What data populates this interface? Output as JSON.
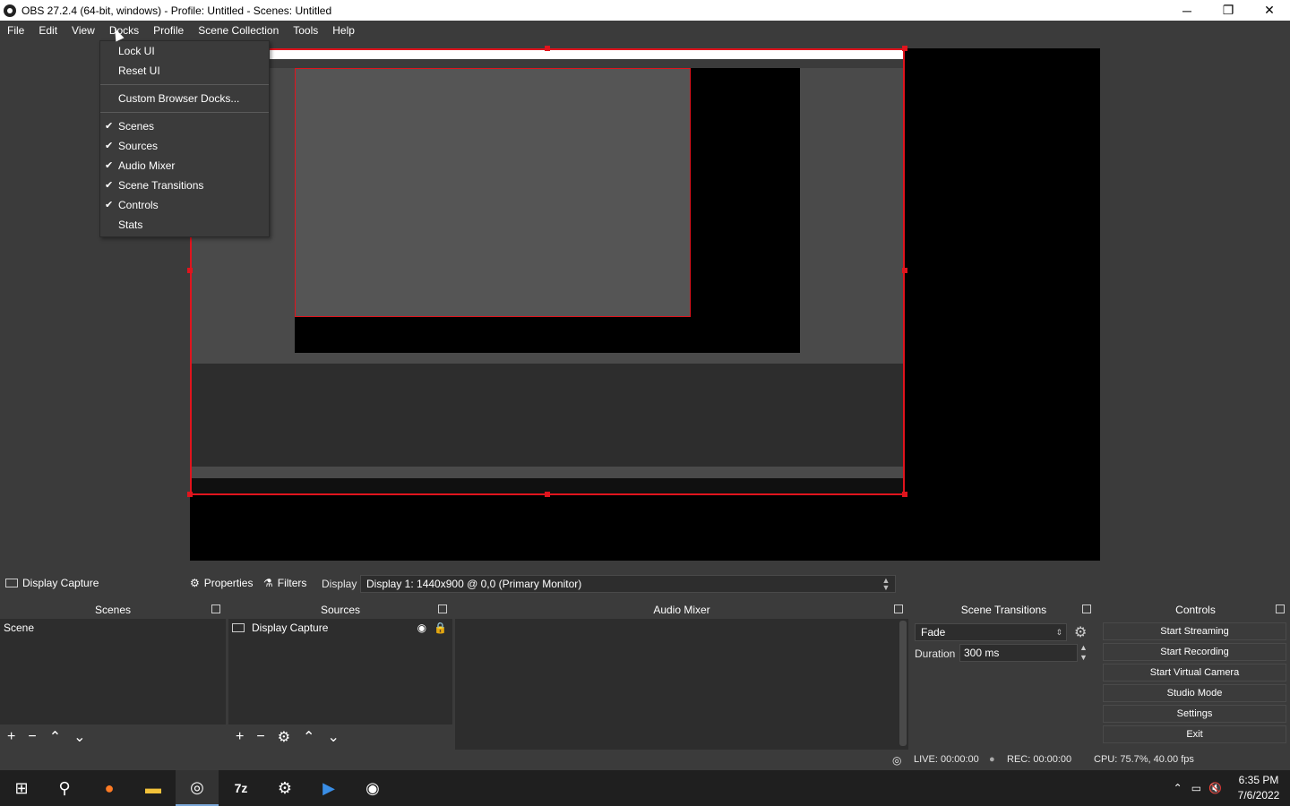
{
  "window": {
    "title": "OBS 27.2.4 (64-bit, windows) - Profile: Untitled - Scenes: Untitled",
    "minimize": "─",
    "maximize": "❐",
    "close": "✕"
  },
  "menu": [
    "File",
    "Edit",
    "View",
    "Docks",
    "Profile",
    "Scene Collection",
    "Tools",
    "Help"
  ],
  "docks_menu": {
    "lock_ui": "Lock UI",
    "reset_ui": "Reset UI",
    "custom_browser_docks": "Custom Browser Docks...",
    "items": [
      {
        "label": "Scenes",
        "checked": "✔"
      },
      {
        "label": "Sources",
        "checked": "✔"
      },
      {
        "label": "Audio Mixer",
        "checked": "✔"
      },
      {
        "label": "Scene Transitions",
        "checked": "✔"
      },
      {
        "label": "Controls",
        "checked": "✔"
      },
      {
        "label": "Stats",
        "checked": ""
      }
    ]
  },
  "source_toolbar": {
    "source_name": "Display Capture",
    "properties": "Properties",
    "filters": "Filters",
    "display_label": "Display",
    "display_value": "Display 1: 1440x900 @ 0,0 (Primary Monitor)"
  },
  "scenes": {
    "header": "Scenes",
    "items": [
      "Scene"
    ]
  },
  "sources": {
    "header": "Sources",
    "items": [
      "Display Capture"
    ]
  },
  "audio_mixer": {
    "header": "Audio Mixer"
  },
  "transitions": {
    "header": "Scene Transitions",
    "selected": "Fade",
    "duration_label": "Duration",
    "duration_value": "300 ms"
  },
  "controls": {
    "header": "Controls",
    "buttons": [
      "Start Streaming",
      "Start Recording",
      "Start Virtual Camera",
      "Studio Mode",
      "Settings",
      "Exit"
    ]
  },
  "status": {
    "live": "LIVE: 00:00:00",
    "rec": "REC: 00:00:00",
    "cpu": "CPU: 75.7%, 40.00 fps"
  },
  "taskbar": {
    "time": "6:35 PM",
    "date": "7/6/2022",
    "zip_label": "7z"
  },
  "colors": {
    "selection_red": "#e0141d",
    "panel_bg": "#2d2d2d",
    "chrome_bg": "#3b3b3b"
  }
}
